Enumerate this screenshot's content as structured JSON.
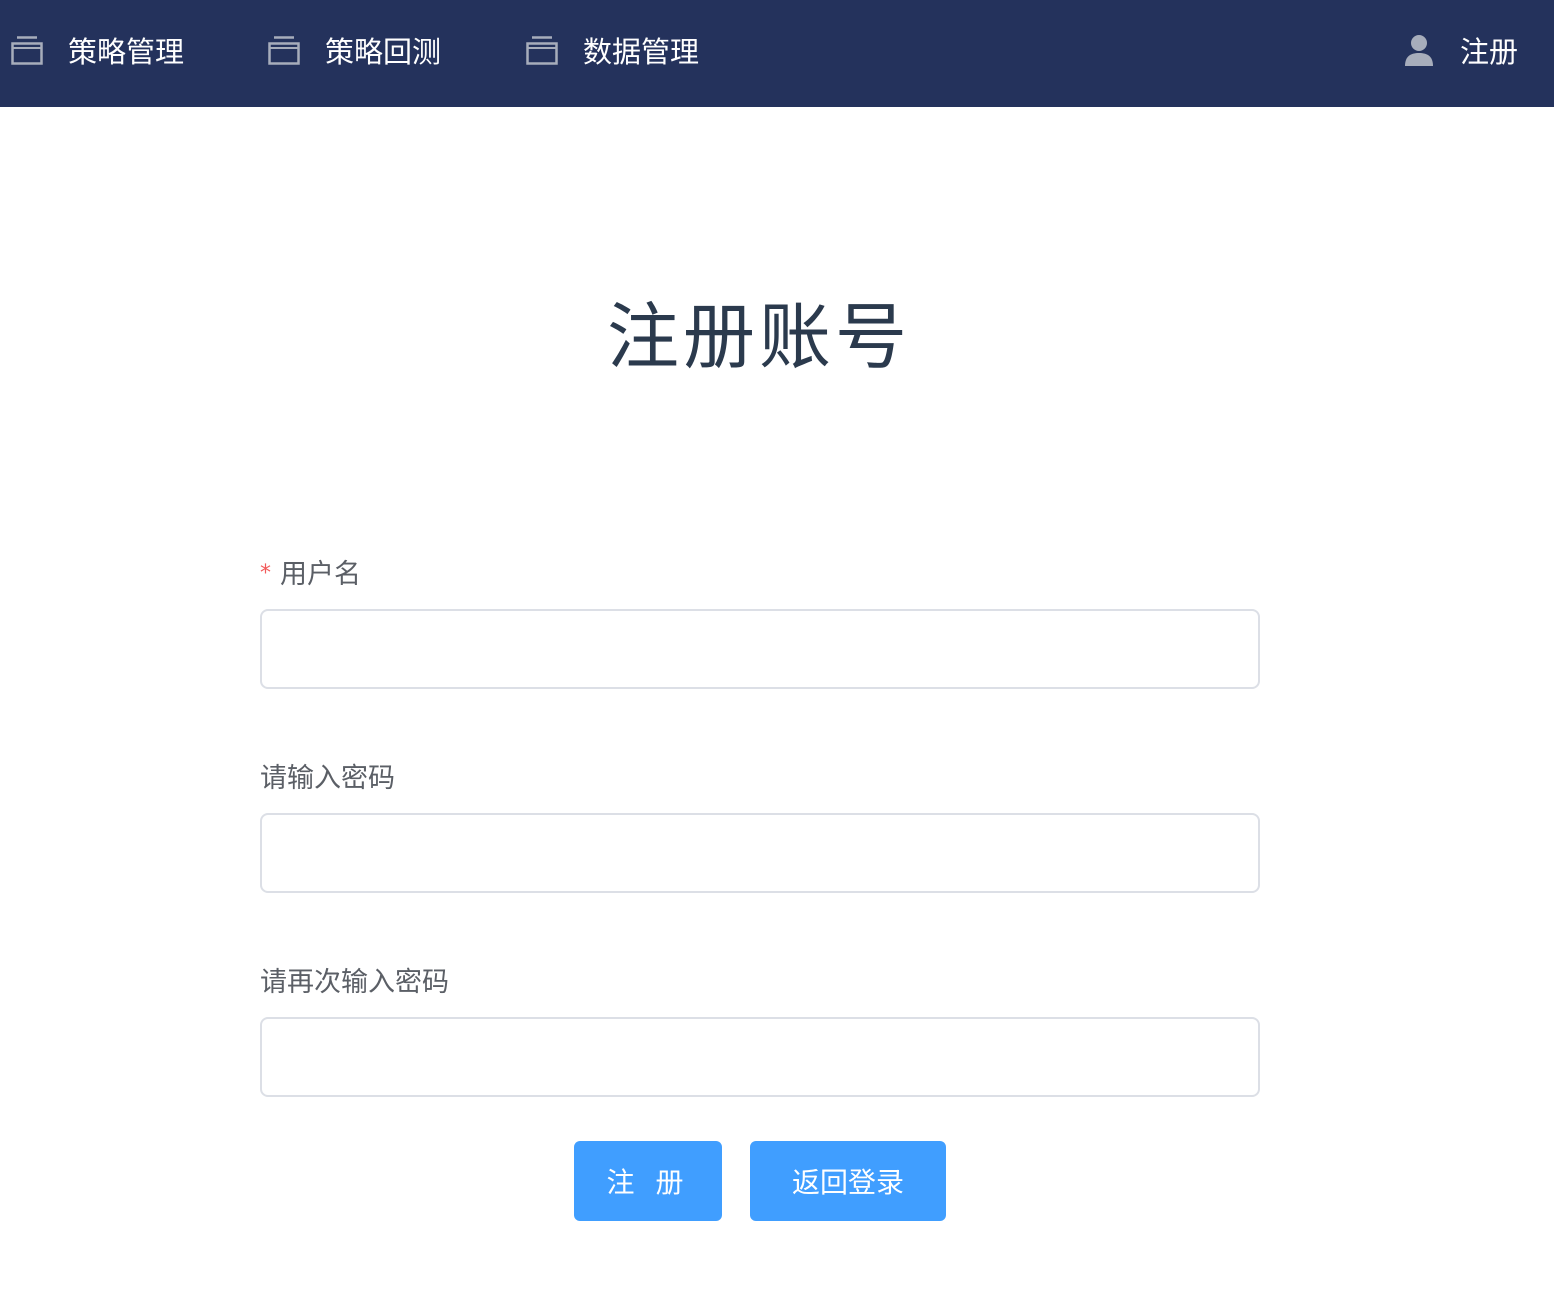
{
  "colors": {
    "nav_bg": "#24325c",
    "primary": "#409eff",
    "required": "#f25a5a",
    "title": "#2b3a4d"
  },
  "nav": {
    "items": [
      {
        "label": "策略管理",
        "icon": "window-icon"
      },
      {
        "label": "策略回测",
        "icon": "window-icon"
      },
      {
        "label": "数据管理",
        "icon": "window-icon"
      }
    ],
    "user": {
      "label": "注册",
      "icon": "user-icon"
    }
  },
  "page": {
    "title": "注册账号"
  },
  "form": {
    "username": {
      "label": "用户名",
      "required_mark": "*",
      "value": "",
      "placeholder": ""
    },
    "password": {
      "label": "请输入密码",
      "value": "",
      "placeholder": ""
    },
    "confirm_password": {
      "label": "请再次输入密码",
      "value": "",
      "placeholder": ""
    }
  },
  "buttons": {
    "register": "注 册",
    "back_to_login": "返回登录"
  }
}
